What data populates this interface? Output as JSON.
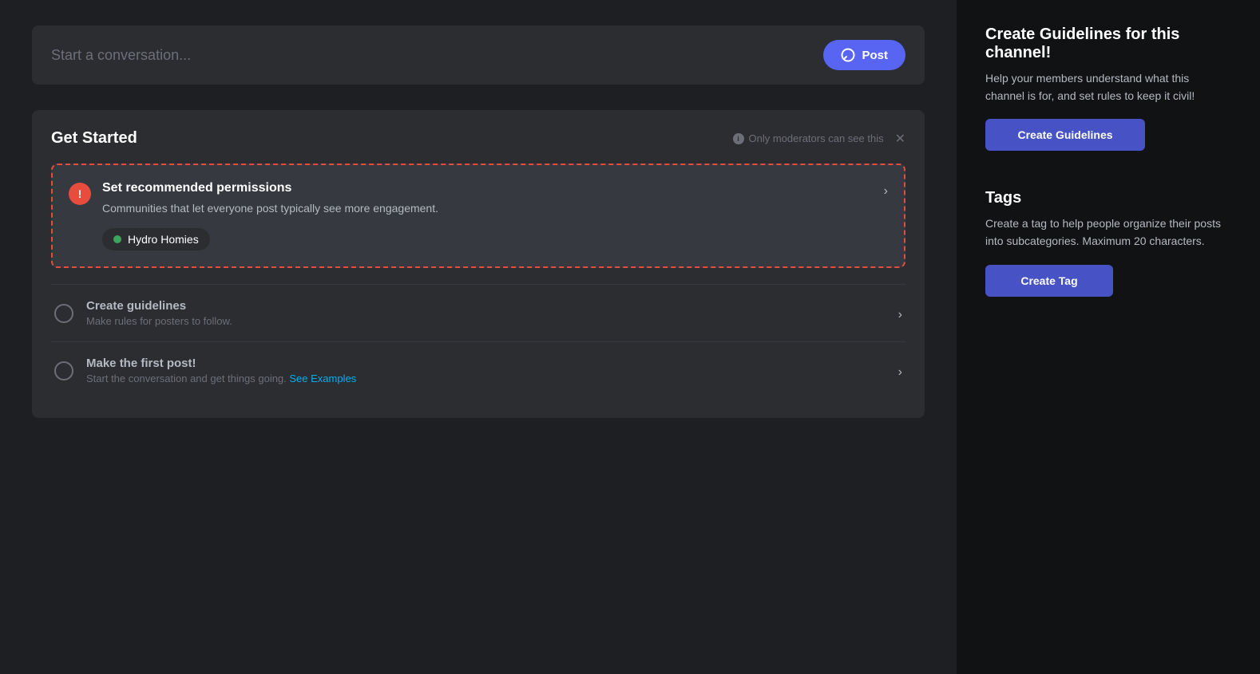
{
  "conversation_bar": {
    "placeholder": "Start a conversation...",
    "post_button_label": "Post"
  },
  "get_started": {
    "title": "Get Started",
    "moderator_notice": "Only moderators can see this",
    "permission_card": {
      "title": "Set recommended permissions",
      "description": "Communities that let everyone post typically see more engagement.",
      "community_name": "Hydro Homies"
    },
    "items": [
      {
        "label": "Create guidelines",
        "sublabel": "Make rules for posters to follow.",
        "see_examples": null
      },
      {
        "label": "Make the first post!",
        "sublabel": "Start the conversation and get things going.",
        "see_examples": "See Examples"
      }
    ]
  },
  "right_panel": {
    "guidelines": {
      "title": "Create Guidelines for this channel!",
      "description": "Help your members understand what this channel is for, and set rules to keep it civil!",
      "button_label": "Create Guidelines"
    },
    "tags": {
      "title": "Tags",
      "description": "Create a tag to help people organize their posts into subcategories. Maximum 20 characters.",
      "button_label": "Create Tag"
    }
  }
}
